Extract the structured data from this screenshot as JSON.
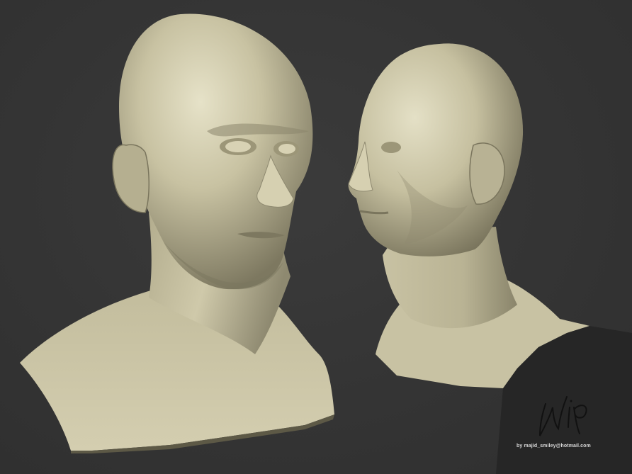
{
  "artwork": {
    "subjects": [
      "head-bust-three-quarter-view",
      "head-bust-side-profile-view"
    ],
    "colors": {
      "background": "#353535",
      "clay": "#c9c3a4",
      "clay_shadow": "#6e6a52",
      "clay_highlight": "#e8e4cc",
      "signature_ink": "#111111"
    }
  },
  "signature": {
    "mark": "wip"
  },
  "credit": {
    "text": "by majid_smiley@hotmail.com"
  }
}
